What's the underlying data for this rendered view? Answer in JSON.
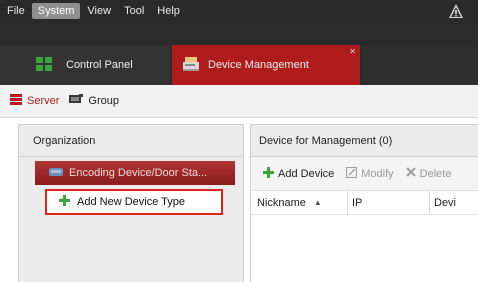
{
  "menubar": {
    "items": [
      {
        "label": "File",
        "active": false
      },
      {
        "label": "System",
        "active": true
      },
      {
        "label": "View",
        "active": false
      },
      {
        "label": "Tool",
        "active": false
      },
      {
        "label": "Help",
        "active": false
      }
    ],
    "alert_icon": "warning-icon"
  },
  "tabs": {
    "control_panel": {
      "label": "Control Panel",
      "icon": "control-panel-grid-icon"
    },
    "device_management": {
      "label": "Device Management",
      "icon": "device-management-icon",
      "active": true
    }
  },
  "subtabs": {
    "server": {
      "label": "Server",
      "icon": "server-icon",
      "active": true
    },
    "group": {
      "label": "Group",
      "icon": "group-icon",
      "active": false
    }
  },
  "left_panel": {
    "header": "Organization",
    "encoding_item": {
      "label": "Encoding Device/Door Sta...",
      "icon": "encoding-device-icon"
    },
    "add_new_type": {
      "label": "Add New Device Type",
      "icon": "plus-icon",
      "highlight_color": "#e0241c"
    }
  },
  "right_panel": {
    "header": "Device for Management (0)",
    "toolbar": {
      "add_device": "Add Device",
      "modify": "Modify",
      "delete": "Delete"
    },
    "columns": {
      "nickname": "Nickname",
      "ip": "IP",
      "device": "Devi"
    }
  },
  "colors": {
    "accent_red": "#b01c1c",
    "menubar_bg": "#2a2a2a",
    "add_green": "#3aa43a"
  }
}
